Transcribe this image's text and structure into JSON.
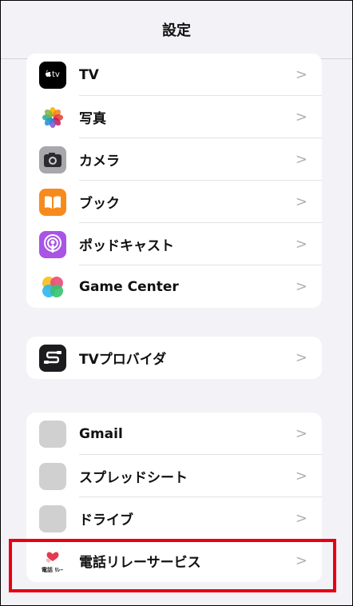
{
  "header": {
    "title": "設定"
  },
  "group1": [
    {
      "label": "TV",
      "icon": "apple-tv-icon",
      "icon_text": "tv"
    },
    {
      "label": "写真",
      "icon": "photos-icon"
    },
    {
      "label": "カメラ",
      "icon": "camera-icon"
    },
    {
      "label": "ブック",
      "icon": "books-icon"
    },
    {
      "label": "ポッドキャスト",
      "icon": "podcasts-icon"
    },
    {
      "label": "Game Center",
      "icon": "game-center-icon"
    }
  ],
  "group2": [
    {
      "label": "TVプロバイダ",
      "icon": "tv-provider-icon"
    }
  ],
  "group3": [
    {
      "label": "Gmail",
      "icon": "gmail-icon"
    },
    {
      "label": "スプレッドシート",
      "icon": "sheets-icon"
    },
    {
      "label": "ドライブ",
      "icon": "drive-icon"
    },
    {
      "label": "電話リレーサービス",
      "icon": "phone-relay-service-icon",
      "icon_text": "電話 ﾘﾚｰ"
    }
  ],
  "chevron": ">",
  "colors": {
    "background": "#f2f2f7",
    "highlight": "#e60012"
  }
}
